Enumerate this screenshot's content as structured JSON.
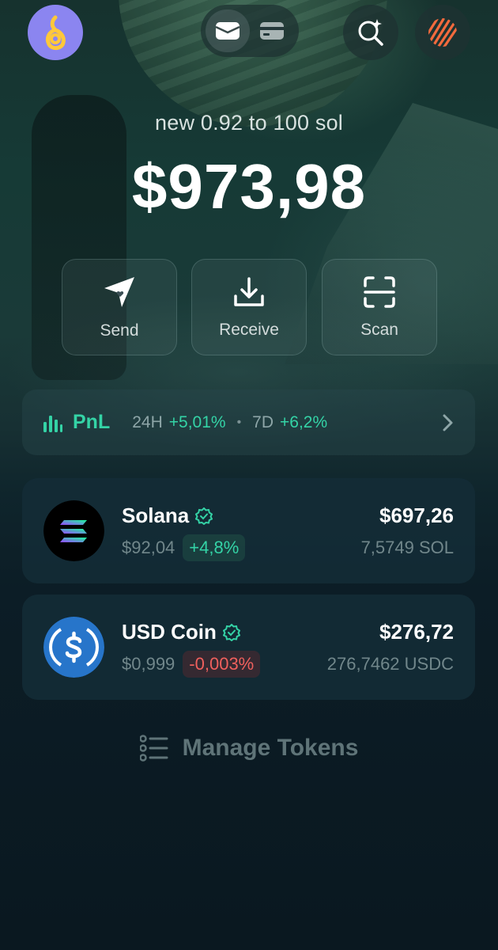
{
  "header": {
    "wallet_tabs": [
      {
        "name": "wallet-icon",
        "active": true
      },
      {
        "name": "card-icon",
        "active": false
      }
    ]
  },
  "account": {
    "name": "new 0.92 to 100 sol",
    "balance": "$973,98"
  },
  "actions": [
    {
      "label": "Send",
      "icon": "send-icon"
    },
    {
      "label": "Receive",
      "icon": "download-icon"
    },
    {
      "label": "Scan",
      "icon": "scan-icon"
    }
  ],
  "pnl": {
    "title": "PnL",
    "period1_label": "24H",
    "period1_value": "+5,01%",
    "separator": "•",
    "period2_label": "7D",
    "period2_value": "+6,2%"
  },
  "tokens": [
    {
      "name": "Solana",
      "price": "$92,04",
      "change": "+4,8%",
      "change_direction": "up",
      "value": "$697,26",
      "amount": "7,5749 SOL",
      "verified": true
    },
    {
      "name": "USD Coin",
      "price": "$0,999",
      "change": "-0,003%",
      "change_direction": "down",
      "value": "$276,72",
      "amount": "276,7462 USDC",
      "verified": true
    }
  ],
  "manage_tokens_label": "Manage Tokens",
  "colors": {
    "accent_green": "#34d3a6",
    "negative_red": "#f0605d",
    "avatar_bg": "#8b85f0",
    "background": "#0a1a22"
  }
}
